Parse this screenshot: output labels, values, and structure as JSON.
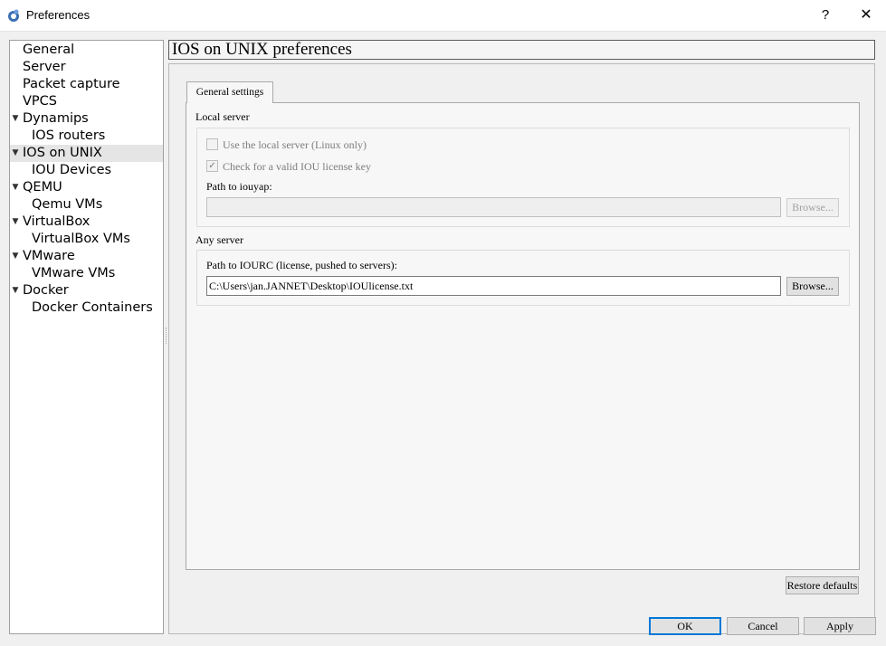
{
  "window": {
    "title": "Preferences",
    "help_label": "?",
    "close_label": "✕"
  },
  "sidebar": {
    "items": [
      {
        "label": "General"
      },
      {
        "label": "Server"
      },
      {
        "label": "Packet capture"
      },
      {
        "label": "VPCS"
      },
      {
        "label": "Dynamips"
      },
      {
        "label": "IOS routers"
      },
      {
        "label": "IOS on UNIX"
      },
      {
        "label": "IOU Devices"
      },
      {
        "label": "QEMU"
      },
      {
        "label": "Qemu VMs"
      },
      {
        "label": "VirtualBox"
      },
      {
        "label": "VirtualBox VMs"
      },
      {
        "label": "VMware"
      },
      {
        "label": "VMware VMs"
      },
      {
        "label": "Docker"
      },
      {
        "label": "Docker Containers"
      }
    ],
    "selected": "IOS on UNIX"
  },
  "page": {
    "title": "IOS on UNIX preferences",
    "tab_label": "General settings",
    "local_server": {
      "section_label": "Local server",
      "use_local_label": "Use the local server (Linux only)",
      "use_local_checked": false,
      "check_license_label": "Check for a valid IOU license key",
      "check_license_checked": true,
      "check_mark": "✓",
      "iouyap_label": "Path to iouyap:",
      "iouyap_value": "",
      "browse_label": "Browse..."
    },
    "any_server": {
      "section_label": "Any server",
      "iourc_label": "Path to IOURC (license, pushed to servers):",
      "iourc_value": "C:\\Users\\jan.JANNET\\Desktop\\IOUlicense.txt",
      "browse_label": "Browse..."
    },
    "restore_defaults_label": "Restore defaults"
  },
  "footer": {
    "ok_label": "OK",
    "cancel_label": "Cancel",
    "apply_label": "Apply"
  }
}
